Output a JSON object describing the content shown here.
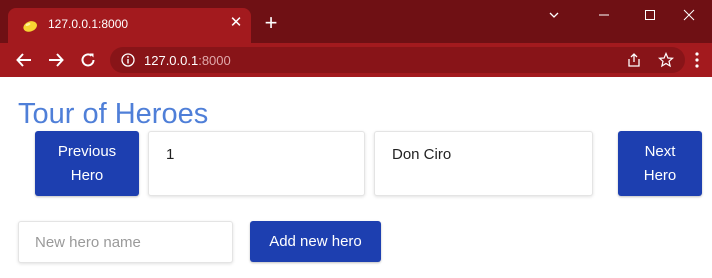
{
  "browser": {
    "tab_title": "127.0.0.1:8000",
    "tab_close_glyph": "✕",
    "new_tab_glyph": "+",
    "url_host": "127.0.0.1",
    "url_port": ":8000",
    "icons": [
      "favicon",
      "close-icon",
      "new-tab-icon",
      "minimize-icon",
      "maximize-icon",
      "window-close-icon",
      "tab-search-icon",
      "back-icon",
      "forward-icon",
      "reload-icon",
      "site-info-icon",
      "share-icon",
      "bookmark-star-icon",
      "menu-icon"
    ],
    "colors": {
      "frame": "#6f1014",
      "toolbar": "#a31a1e",
      "omnibox": "#881418"
    }
  },
  "page": {
    "title": "Tour of Heroes",
    "prev_button": "Previous Hero",
    "next_button": "Next Hero",
    "hero_id": "1",
    "hero_name": "Don Ciro",
    "new_hero_placeholder": "New hero name",
    "add_button": "Add new hero",
    "colors": {
      "title": "#4f7fd8",
      "button": "#1d3fb0"
    }
  }
}
